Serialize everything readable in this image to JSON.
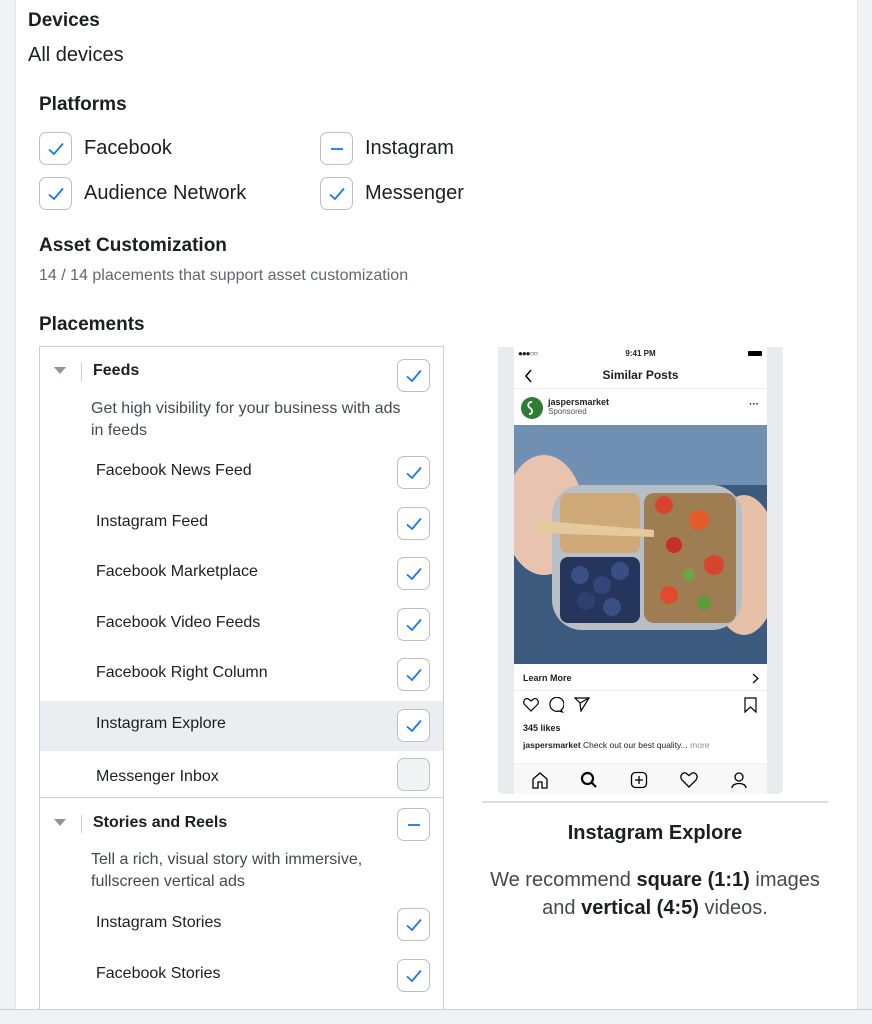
{
  "devices": {
    "heading": "Devices",
    "value": "All devices"
  },
  "platforms": {
    "heading": "Platforms",
    "items": [
      {
        "label": "Facebook",
        "state": "checked"
      },
      {
        "label": "Instagram",
        "state": "indeterminate"
      },
      {
        "label": "Audience Network",
        "state": "checked"
      },
      {
        "label": "Messenger",
        "state": "checked"
      }
    ]
  },
  "asset_customization": {
    "heading": "Asset Customization",
    "summary": "14 / 14 placements that support asset customization"
  },
  "placements": {
    "heading": "Placements",
    "groups": [
      {
        "title": "Feeds",
        "state": "checked",
        "description": "Get high visibility for your business with ads in feeds",
        "items": [
          {
            "label": "Facebook News Feed",
            "state": "checked"
          },
          {
            "label": "Instagram Feed",
            "state": "checked"
          },
          {
            "label": "Facebook Marketplace",
            "state": "checked"
          },
          {
            "label": "Facebook Video Feeds",
            "state": "checked"
          },
          {
            "label": "Facebook Right Column",
            "state": "checked"
          },
          {
            "label": "Instagram Explore",
            "state": "checked",
            "highlighted": true
          },
          {
            "label": "Messenger Inbox",
            "state": "unchecked"
          }
        ]
      },
      {
        "title": "Stories and Reels",
        "state": "indeterminate",
        "description": "Tell a rich, visual story with immersive, fullscreen vertical ads",
        "items": [
          {
            "label": "Instagram Stories",
            "state": "checked"
          },
          {
            "label": "Facebook Stories",
            "state": "checked"
          }
        ]
      }
    ]
  },
  "preview": {
    "phone": {
      "time": "9:41 PM",
      "nav_title": "Similar Posts",
      "account": "jaspersmarket",
      "sponsored": "Sponsored",
      "more_dots": "···",
      "cta": "Learn More",
      "likes": "345 likes",
      "caption_account": "jaspersmarket",
      "caption_text": "Check out our best quality...",
      "caption_more": "more"
    },
    "title": "Instagram Explore",
    "desc_1": "We recommend",
    "desc_2": "square (1:1)",
    "desc_3": "images",
    "desc_4": "and",
    "desc_5": "vertical (4:5)",
    "desc_6": "videos."
  },
  "colors": {
    "accent": "#1877f2",
    "border": "#ccd0d5",
    "highlight": "#ebedf0"
  },
  "icons": {
    "check": "check-icon",
    "minus": "minus-icon",
    "triangle": "caret-down-icon"
  }
}
